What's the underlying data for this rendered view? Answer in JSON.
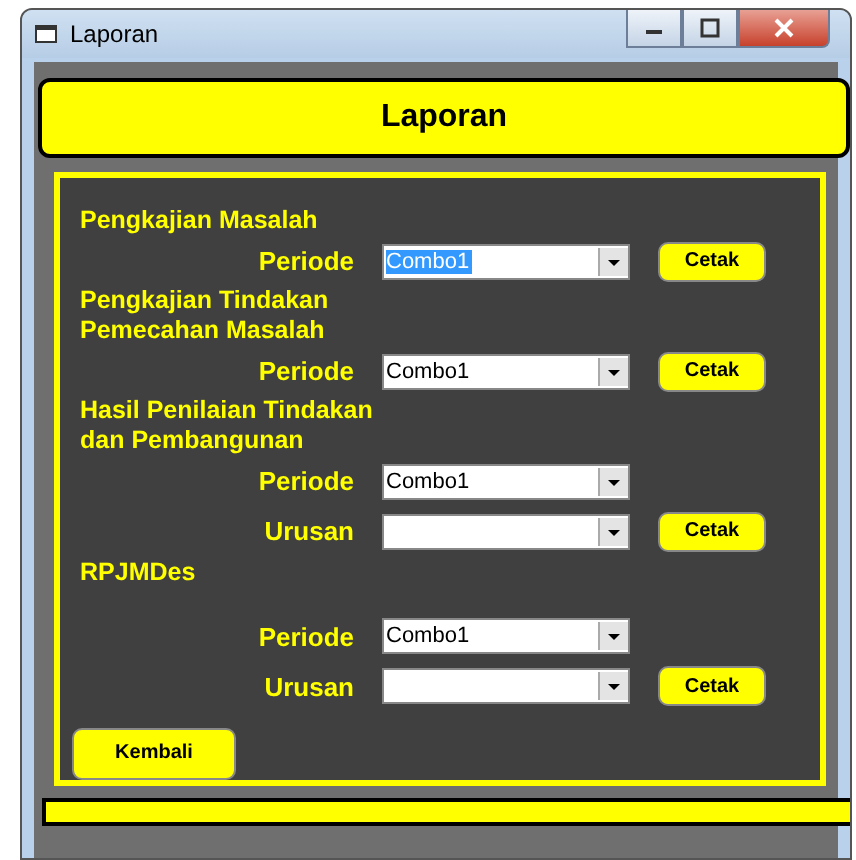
{
  "window": {
    "title": "Laporan"
  },
  "header": "Laporan",
  "sections": [
    {
      "title": "Pengkajian Masalah",
      "fields": [
        {
          "label": "Periode",
          "value": "Combo1",
          "highlighted": true
        }
      ],
      "button": "Cetak"
    },
    {
      "title": "Pengkajian Tindakan Pemecahan Masalah",
      "fields": [
        {
          "label": "Periode",
          "value": "Combo1"
        }
      ],
      "button": "Cetak"
    },
    {
      "title": "Hasil Penilaian Tindakan dan Pembangunan",
      "fields": [
        {
          "label": "Periode",
          "value": "Combo1"
        },
        {
          "label": "Urusan"
        }
      ],
      "button": "Cetak"
    },
    {
      "title": "RPJMDes",
      "fields": [
        {
          "label": "Periode",
          "value": "Combo1"
        },
        {
          "label": "Urusan"
        }
      ],
      "button": "Cetak"
    }
  ],
  "back_button": "Kembali"
}
